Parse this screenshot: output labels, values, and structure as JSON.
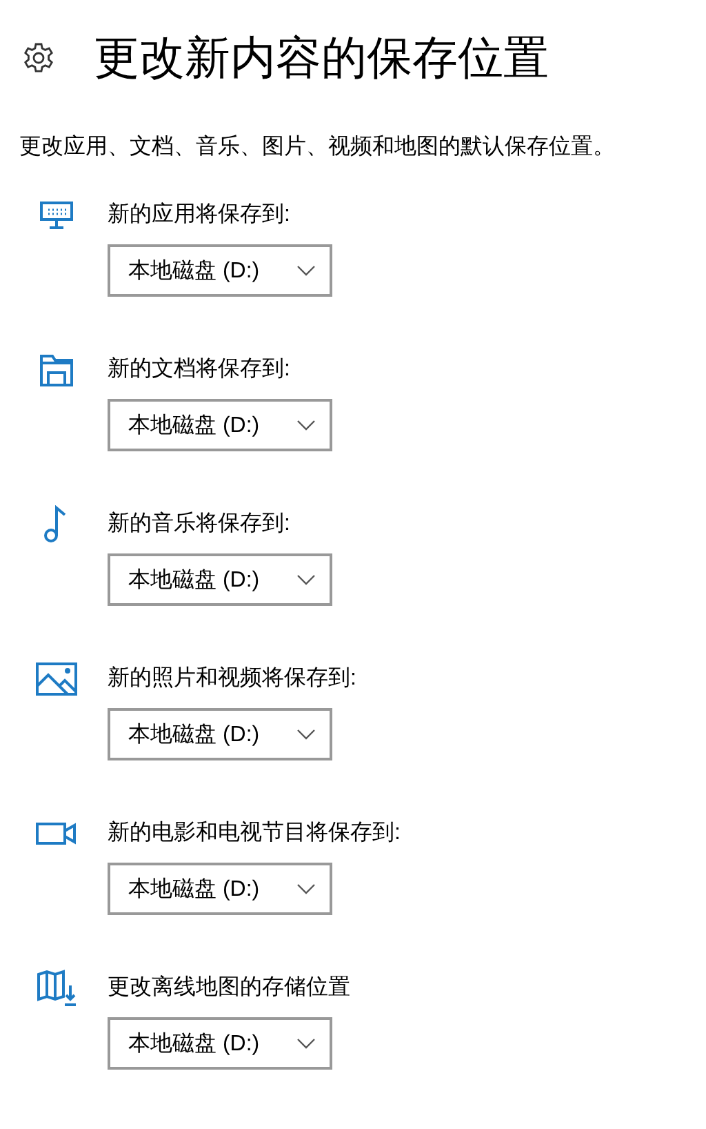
{
  "header": {
    "title": "更改新内容的保存位置"
  },
  "description": "更改应用、文档、音乐、图片、视频和地图的默认保存位置。",
  "locations": [
    {
      "kind": "apps",
      "label": "新的应用将保存到:",
      "value": "本地磁盘 (D:)"
    },
    {
      "kind": "documents",
      "label": "新的文档将保存到:",
      "value": "本地磁盘 (D:)"
    },
    {
      "kind": "music",
      "label": "新的音乐将保存到:",
      "value": "本地磁盘 (D:)"
    },
    {
      "kind": "pictures",
      "label": "新的照片和视频将保存到:",
      "value": "本地磁盘 (D:)"
    },
    {
      "kind": "videos",
      "label": "新的电影和电视节目将保存到:",
      "value": "本地磁盘 (D:)"
    },
    {
      "kind": "maps",
      "label": "更改离线地图的存储位置",
      "value": "本地磁盘 (D:)"
    }
  ]
}
